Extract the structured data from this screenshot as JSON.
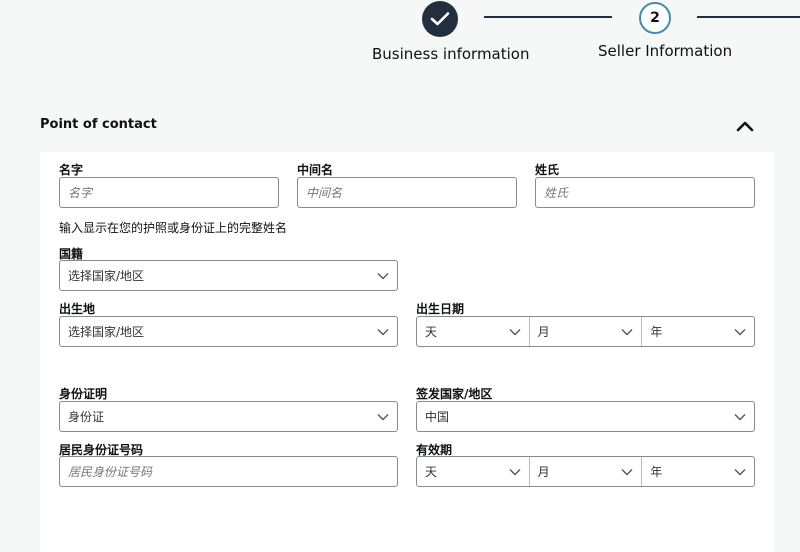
{
  "stepper": {
    "step1": {
      "label": "Business information",
      "status": "complete"
    },
    "step2": {
      "number": "2",
      "label": "Seller Information"
    }
  },
  "section": {
    "title": "Point of contact"
  },
  "form": {
    "first_name": {
      "label": "名字",
      "placeholder": "名字"
    },
    "middle_name": {
      "label": "中间名",
      "placeholder": "中间名"
    },
    "last_name": {
      "label": "姓氏",
      "placeholder": "姓氏"
    },
    "name_hint": "输入显示在您的护照或身份证上的完整姓名",
    "nationality": {
      "label": "国籍",
      "value": "选择国家/地区"
    },
    "birthplace": {
      "label": "出生地",
      "value": "选择国家/地区"
    },
    "birth_date": {
      "label": "出生日期",
      "day": "天",
      "month": "月",
      "year": "年"
    },
    "id_type": {
      "label": "身份证明",
      "value": "身份证"
    },
    "issuing_country": {
      "label": "签发国家/地区",
      "value": "中国"
    },
    "id_number": {
      "label": "居民身份证号码",
      "placeholder": "居民身份证号码"
    },
    "expiry": {
      "label": "有效期",
      "day": "天",
      "month": "月",
      "year": "年"
    }
  }
}
